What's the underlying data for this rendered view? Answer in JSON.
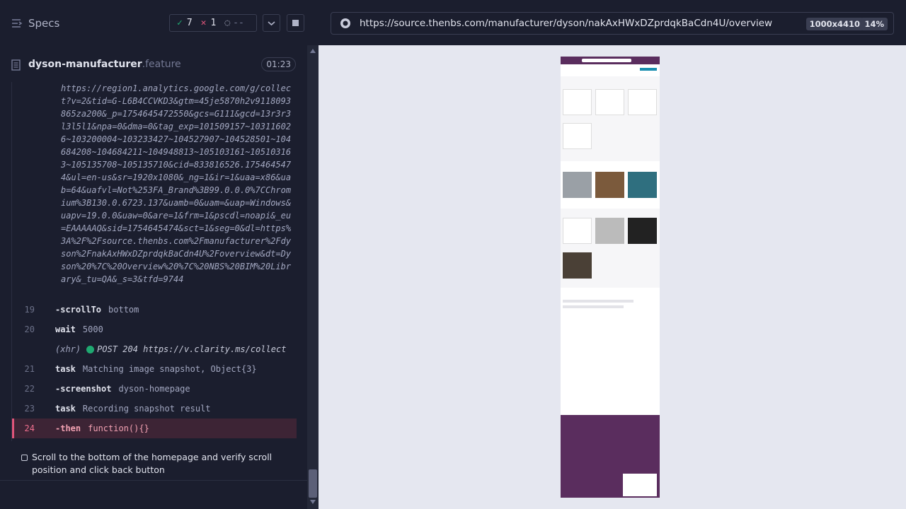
{
  "header": {
    "specs_label": "Specs",
    "passed": "7",
    "failed": "1",
    "pending": "--"
  },
  "file": {
    "name": "dyson-manufacturer",
    "ext": ".feature",
    "duration": "01:23"
  },
  "log": {
    "url_text": "https://region1.analytics.google.com/g/collect?v=2&tid=G-L6B4CCVKD3&gtm=45je5870h2v9118093865za200&_p=1754645472550&gcs=G111&gcd=13r3r3l3l5l1&npa=0&dma=0&tag_exp=101509157~103116026~103200004~103233427~104527907~104528501~104684208~104684211~104948813~105103161~105103163~105135708~105135710&cid=833816526.1754645474&ul=en-us&sr=1920x1080&_ng=1&ir=1&uaa=x86&uab=64&uafvl=Not%253FA_Brand%3B99.0.0.0%7CChromium%3B130.0.6723.137&uamb=0&uam=&uap=Windows&uapv=19.0.0&uaw=0&are=1&frm=1&pscdl=noapi&_eu=EAAAAAQ&sid=1754645474&sct=1&seg=0&dl=https%3A%2F%2Fsource.thenbs.com%2Fmanufacturer%2Fdyson%2FnakAxHWxDZprdqkBaCdn4U%2Foverview&dt=Dyson%20%7C%20Overview%20%7C%20NBS%20BIM%20Library&_tu=QA&_s=3&tfd=9744",
    "commands": [
      {
        "num": "19",
        "name": "-scrollTo",
        "arg": "bottom"
      },
      {
        "num": "20",
        "name": "wait",
        "arg": "5000"
      },
      {
        "num": "",
        "name": "(xhr)",
        "arg": "POST 204 https://v.clarity.ms/collect"
      },
      {
        "num": "21",
        "name": "task",
        "arg": "Matching image snapshot, Object{3}"
      },
      {
        "num": "22",
        "name": "-screenshot",
        "arg": "dyson-homepage"
      },
      {
        "num": "23",
        "name": "task",
        "arg": "Recording snapshot result"
      },
      {
        "num": "24",
        "name": "-then",
        "arg": "function(){}"
      }
    ]
  },
  "test": {
    "title": "Scroll to the bottom of the homepage and verify scroll position and click back button"
  },
  "browser": {
    "url": "https://source.thenbs.com/manufacturer/dyson/nakAxHWxDZprdqkBaCdn4U/overview",
    "viewport": "1000x4410",
    "zoom": "14%"
  },
  "colors": {
    "accent": "#1fa971",
    "fail": "#e0557a",
    "preview_footer": "#5a2d5e"
  },
  "icons": {
    "specs": "list-icon",
    "passed": "check-icon",
    "failed": "x-icon",
    "pending": "spinner-icon",
    "file": "document-icon",
    "url": "globe-icon"
  }
}
